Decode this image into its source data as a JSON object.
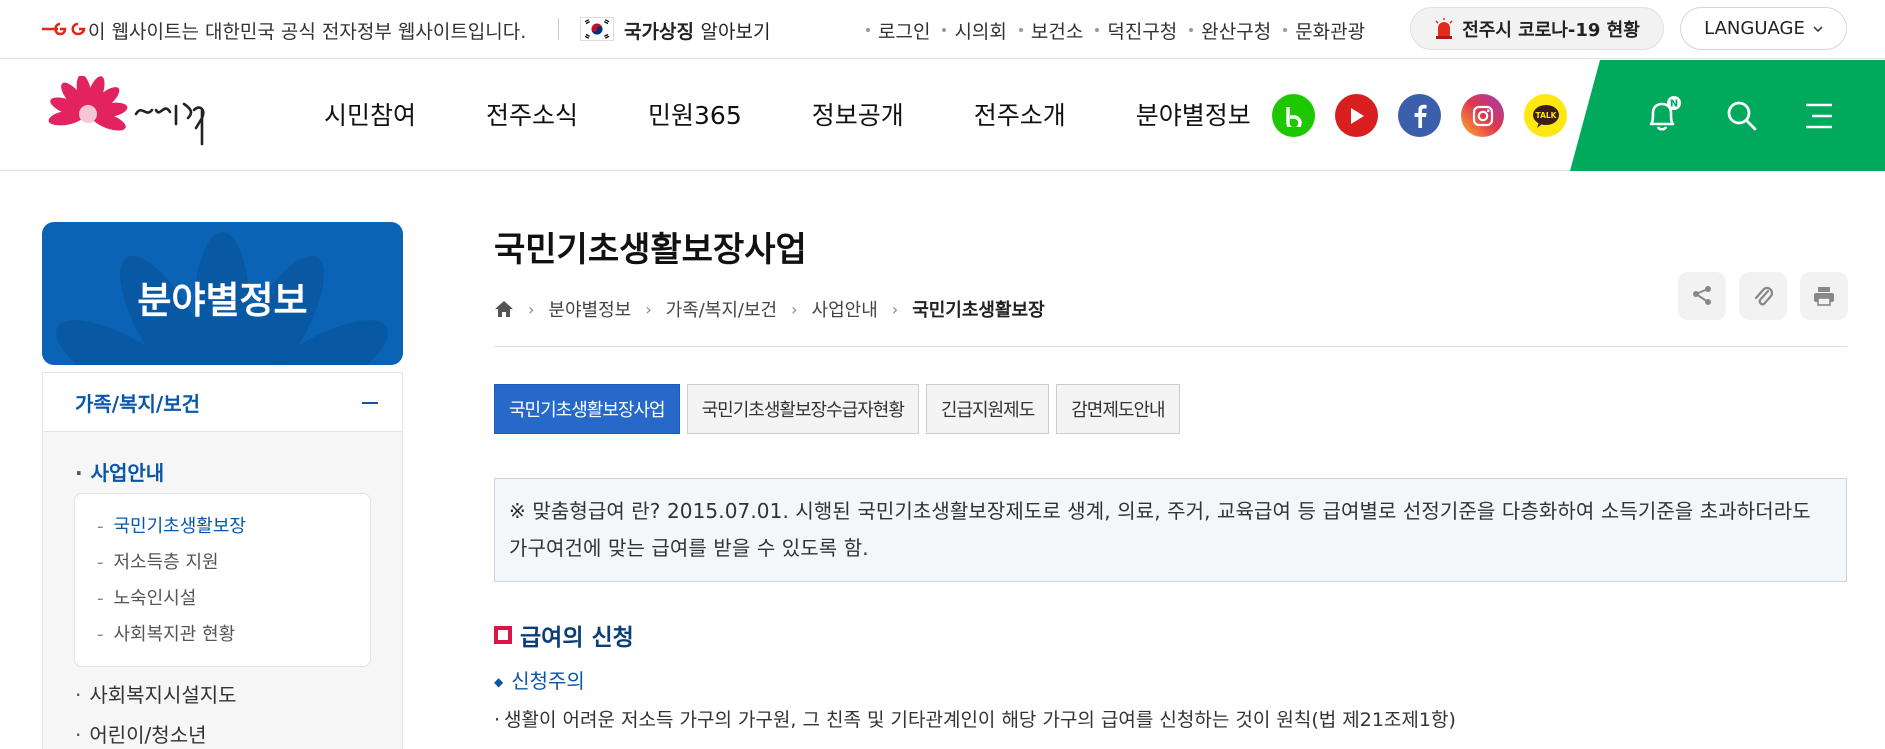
{
  "topbar": {
    "gov_text": "이 웹사이트는 대한민국 공식 전자정부 웹사이트입니다.",
    "symbol_label": "국가상징",
    "symbol_suffix": "알아보기",
    "links": [
      "로그인",
      "시의회",
      "보건소",
      "덕진구청",
      "완산구청",
      "문화관광"
    ],
    "corona_label": "전주시 코로나-19 현황",
    "language_label": "LANGUAGE"
  },
  "header": {
    "logo_alt": "한바탕 전주",
    "nav": [
      "시민참여",
      "전주소식",
      "민원365",
      "정보공개",
      "전주소개",
      "분야별정보"
    ],
    "sns": [
      {
        "name": "blog",
        "color": "#1ec800",
        "glyph": "b"
      },
      {
        "name": "youtube",
        "color": "#d81e1e",
        "glyph": "▶"
      },
      {
        "name": "facebook",
        "color": "#3b5fab",
        "glyph": "f"
      },
      {
        "name": "instagram",
        "color": "#d6249f",
        "glyph": "◎"
      },
      {
        "name": "kakaotalk",
        "color": "#ffe812",
        "glyph": "TALK"
      }
    ],
    "notification_badge": "N",
    "brand_green": "#00a95c"
  },
  "sidebar": {
    "banner_title": "분야별정보",
    "category": "가족/복지/보건",
    "items": [
      {
        "label": "사업안내",
        "active": true
      },
      {
        "label": "사회복지시설지도",
        "active": false
      },
      {
        "label": "어린이/청소년",
        "active": false
      }
    ],
    "sub_items": [
      {
        "label": "국민기초생활보장",
        "active": true
      },
      {
        "label": "저소득층 지원",
        "active": false
      },
      {
        "label": "노숙인시설",
        "active": false
      },
      {
        "label": "사회복지관 현황",
        "active": false
      }
    ]
  },
  "content": {
    "page_title": "국민기초생활보장사업",
    "breadcrumb": [
      "분야별정보",
      "가족/복지/보건",
      "사업안내",
      "국민기초생활보장"
    ],
    "tools": [
      "share-icon",
      "attach-icon",
      "print-icon"
    ],
    "tabs": [
      {
        "label": "국민기초생활보장사업",
        "active": true
      },
      {
        "label": "국민기초생활보장수급자현황",
        "active": false
      },
      {
        "label": "긴급지원제도",
        "active": false
      },
      {
        "label": "감면제도안내",
        "active": false
      }
    ],
    "notice": "※ 맞춤형급여 란? 2015.07.01. 시행된 국민기초생활보장제도로 생계, 의료, 주거, 교육급여 등 급여별로 선정기준을 다층화하여 소득기준을 초과하더라도 가구여건에 맞는 급여를 받을 수 있도록 함.",
    "section_title": "급여의 신청",
    "sub_title": "신청주의",
    "body_text": "생활이 어려운 저소득 가구의 가구원, 그 친족 및 기타관계인이 해당 가구의 급여를 신청하는 것이 원칙(법 제21조제1항)"
  }
}
